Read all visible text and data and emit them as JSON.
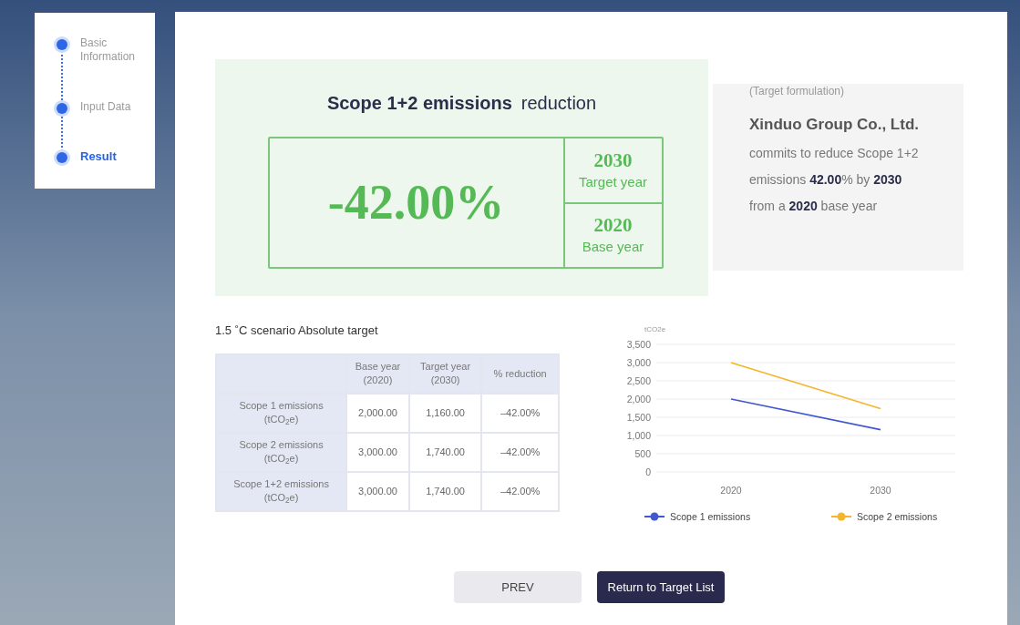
{
  "steps": [
    {
      "label": "Basic Information",
      "selected": false
    },
    {
      "label": "Input Data",
      "selected": false
    },
    {
      "label": "Result",
      "selected": true
    }
  ],
  "summary": {
    "title_bold": "Scope 1+2 emissions",
    "title_rest": "reduction",
    "value": "-42.00%",
    "target_year": "2030",
    "target_year_label": "Target year",
    "base_year": "2020",
    "base_year_label": "Base year"
  },
  "formulation": {
    "caption": "(Target formulation)",
    "company": "Xinduo Group Co., Ltd.",
    "statement": "commits to reduce Scope 1+2 emissions **42.00**% by **2030** from a **2020** base year"
  },
  "table": {
    "title": "1.5 ˚C scenario Absolute target",
    "columns": [
      "Base year (2020)",
      "Target year (2030)",
      "% reduction"
    ],
    "rows": [
      {
        "label": "Scope 1 emissions (tCO$_{2}$e)",
        "cells": [
          "2,000.00",
          "1,160.00",
          "–42.00%"
        ]
      },
      {
        "label": "Scope 2 emissions (tCO$_{2}$e)",
        "cells": [
          "3,000.00",
          "1,740.00",
          "–42.00%"
        ]
      },
      {
        "label": "Scope 1+2 emissions (tCO$_{2}$e)",
        "cells": [
          "3,000.00",
          "1,740.00",
          "–42.00%"
        ]
      }
    ]
  },
  "chart_data": {
    "type": "line",
    "ylabel": "tCO2e",
    "categories": [
      "2020",
      "2030"
    ],
    "series": [
      {
        "name": "Scope 1 emissions",
        "color": "#4258d0",
        "values": [
          2000,
          1160
        ]
      },
      {
        "name": "Scope 2 emissions",
        "color": "#f5b52a",
        "values": [
          3000,
          1740
        ]
      }
    ],
    "ylim": [
      0,
      3500
    ],
    "grid": true,
    "legend": "bottom",
    "yticks": [
      {
        "value": 0,
        "label": "0"
      },
      {
        "value": 500,
        "label": "500"
      },
      {
        "value": 1000,
        "label": "1,000"
      },
      {
        "value": 1500,
        "label": "1,500"
      },
      {
        "value": 2000,
        "label": "2,000"
      },
      {
        "value": 2500,
        "label": "2,500"
      },
      {
        "value": 3000,
        "label": "3,000"
      },
      {
        "value": 3500,
        "label": "3,500"
      }
    ]
  },
  "buttons": [
    {
      "label": "PREV",
      "kind": "secondary"
    },
    {
      "label": "Return to Target List",
      "kind": "primary"
    }
  ]
}
